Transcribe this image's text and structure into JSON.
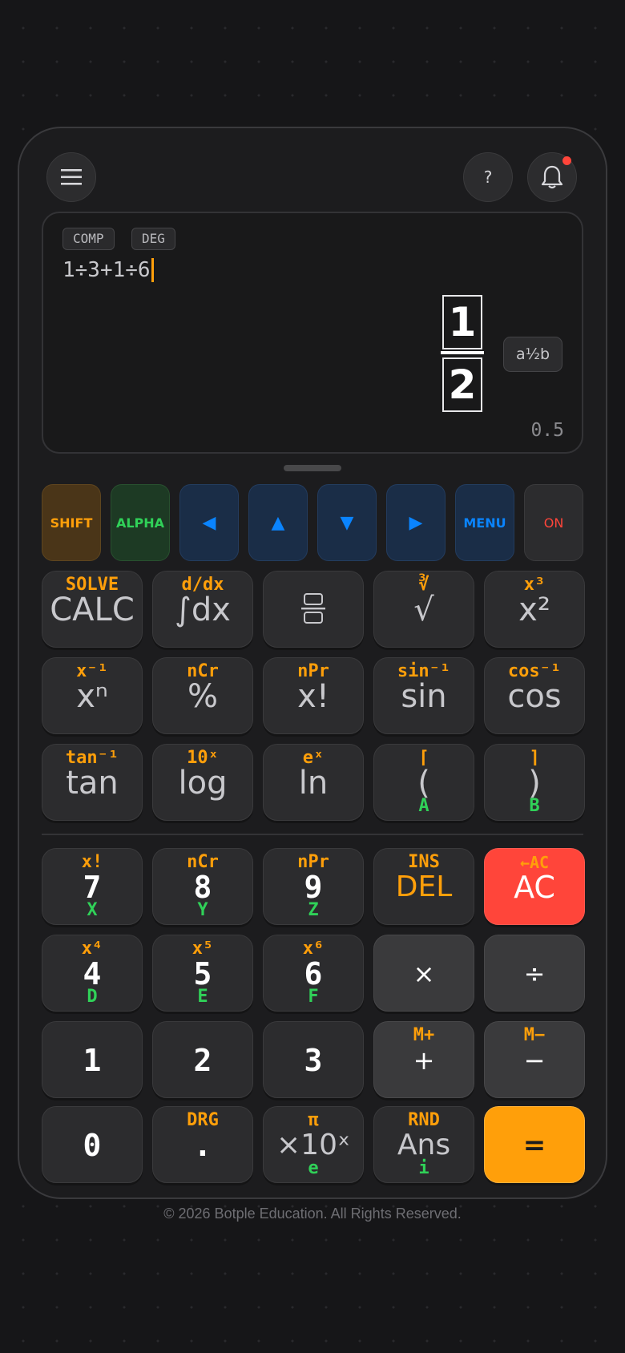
{
  "header": {
    "help_label": "?"
  },
  "screen": {
    "mode_labels": [
      "COMP",
      "DEG"
    ],
    "expression": "1÷3+1÷6",
    "result_numerator": "1",
    "result_denominator": "2",
    "format_button": "a½b",
    "decimal_value": "0.5"
  },
  "function_row": {
    "shift": "SHIFT",
    "alpha": "ALPHA",
    "left": "◀",
    "up": "▲",
    "down": "▼",
    "right": "▶",
    "menu": "MENU",
    "on": "ON"
  },
  "keys": {
    "calc": {
      "sup": "SOLVE",
      "main": "CALC"
    },
    "integral": {
      "sup": "d/dx",
      "main": "∫dx"
    },
    "fraction": {
      "sup": ""
    },
    "sqrt": {
      "sup": "∛",
      "main": "√"
    },
    "square": {
      "sup": "x³",
      "main": "x²"
    },
    "power": {
      "sup": "x⁻¹",
      "main": "xⁿ"
    },
    "percent": {
      "sup": "nCr",
      "main": "%"
    },
    "factorial": {
      "sup": "nPr",
      "main": "x!"
    },
    "sin": {
      "sup": "sin⁻¹",
      "main": "sin"
    },
    "cos": {
      "sup": "cos⁻¹",
      "main": "cos"
    },
    "tan": {
      "sup": "tan⁻¹",
      "main": "tan"
    },
    "log": {
      "sup": "10ˣ",
      "main": "log"
    },
    "ln": {
      "sup": "eˣ",
      "main": "ln"
    },
    "lparen": {
      "sup": "⌈",
      "main": "(",
      "sub": "A"
    },
    "rparen": {
      "sup": "⌉",
      "main": ")",
      "sub": "B"
    },
    "seven": {
      "sup": "x!",
      "main": "7",
      "sub": "X"
    },
    "eight": {
      "sup": "nCr",
      "main": "8",
      "sub": "Y"
    },
    "nine": {
      "sup": "nPr",
      "main": "9",
      "sub": "Z"
    },
    "del": {
      "sup": "INS",
      "main": "DEL"
    },
    "ac": {
      "sup": "←AC",
      "main": "AC"
    },
    "four": {
      "sup": "x⁴",
      "main": "4",
      "sub": "D"
    },
    "five": {
      "sup": "x⁵",
      "main": "5",
      "sub": "E"
    },
    "six": {
      "sup": "x⁶",
      "main": "6",
      "sub": "F"
    },
    "multiply": {
      "main": "×"
    },
    "divide": {
      "main": "÷"
    },
    "one": {
      "main": "1"
    },
    "two": {
      "main": "2"
    },
    "three": {
      "main": "3"
    },
    "plus": {
      "sup": "M+",
      "main": "+"
    },
    "minus": {
      "sup": "M−",
      "main": "−"
    },
    "zero": {
      "main": "0"
    },
    "dot": {
      "sup": "DRG",
      "main": "."
    },
    "exp": {
      "sup": "π",
      "main": "×10ˣ",
      "sub": "e"
    },
    "ans": {
      "sup": "RND",
      "main": "Ans",
      "sub": "i"
    },
    "equals": {
      "main": "="
    }
  },
  "colors": {
    "accent_orange": "#ff9f0a",
    "alpha_green": "#30d158",
    "nav_blue": "#0a84ff",
    "ac_red": "#ff453a",
    "notification_dot": "#ff453a"
  },
  "footer": {
    "copyright": "© 2026 Botple Education. All Rights Reserved."
  }
}
